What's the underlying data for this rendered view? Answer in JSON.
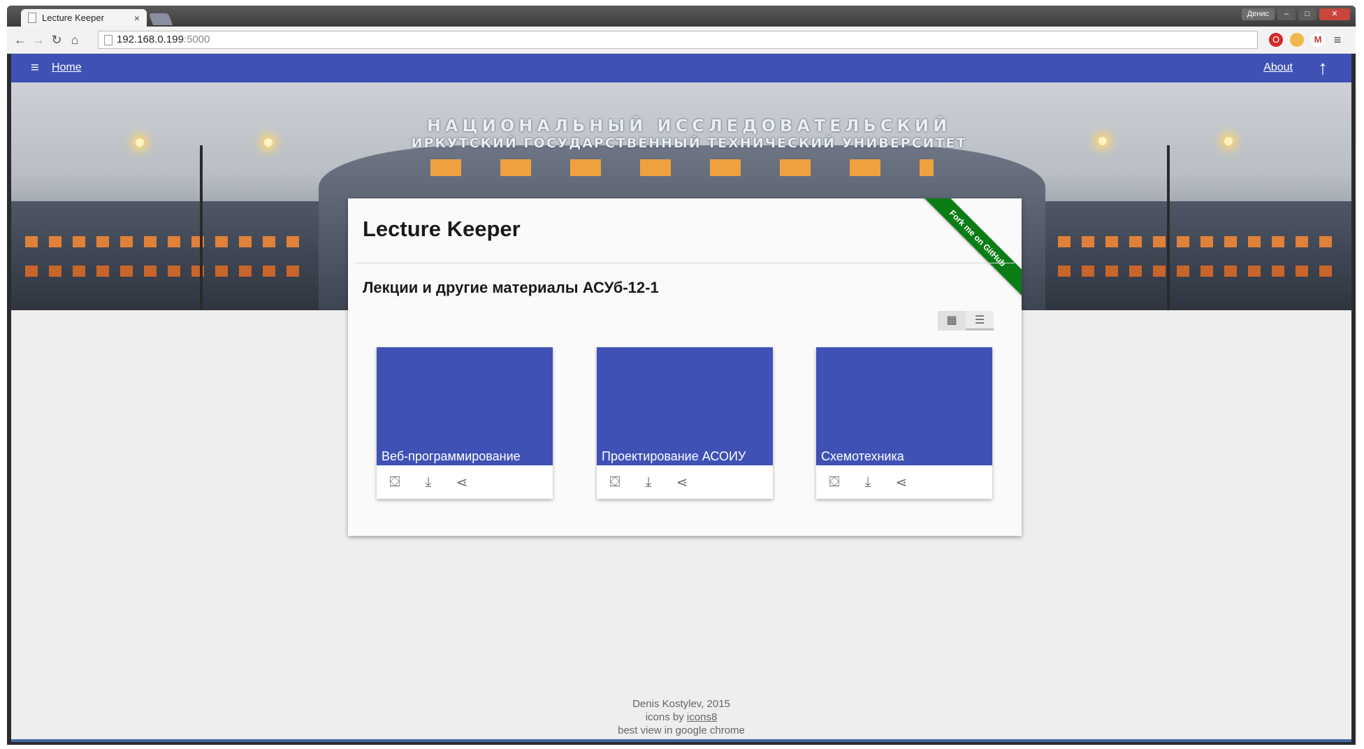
{
  "browser": {
    "tab_title": "Lecture Keeper",
    "tab_close": "×",
    "user_label": "Денис",
    "url_host": "192.168.0.199",
    "url_port": ":5000",
    "nav": {
      "back": "←",
      "forward": "→",
      "reload": "↻",
      "home": "⌂"
    },
    "extensions": {
      "opera": "O",
      "gmail": "M",
      "menu": "≡"
    },
    "window_controls": {
      "minimize": "–",
      "maximize": "□",
      "close": "✕"
    }
  },
  "appbar": {
    "menu_icon": "≡",
    "home_label": "Home",
    "about_label": "About",
    "up_icon": "↑",
    "color": "#3f51b5"
  },
  "hero": {
    "sign_line1": "НАЦИОНАЛЬНЫЙ ИССЛЕДОВАТЕЛЬСКИЙ",
    "sign_line2": "ИРКУТСКИЙ ГОСУДАРСТВЕННЫЙ ТЕХНИЧЕСКИЙ УНИВЕРСИТЕТ"
  },
  "panel": {
    "title": "Lecture Keeper",
    "ribbon": "Fork me on GitHub",
    "subtitle": "Лекции и другие материалы АСУб-12-1",
    "view_grid_icon": "▦",
    "view_list_icon": "☰"
  },
  "cards": [
    {
      "name": "Веб-программирование"
    },
    {
      "name": "Проектирование АСОИУ"
    },
    {
      "name": "Схемотехника"
    }
  ],
  "card_actions": {
    "package": "⛋",
    "download": "⤓",
    "share": "⋖"
  },
  "footer": {
    "line1": "Denis Kostylev, 2015",
    "line2_prefix": "icons by ",
    "line2_link": "icons8",
    "line3": "best view in google chrome"
  }
}
